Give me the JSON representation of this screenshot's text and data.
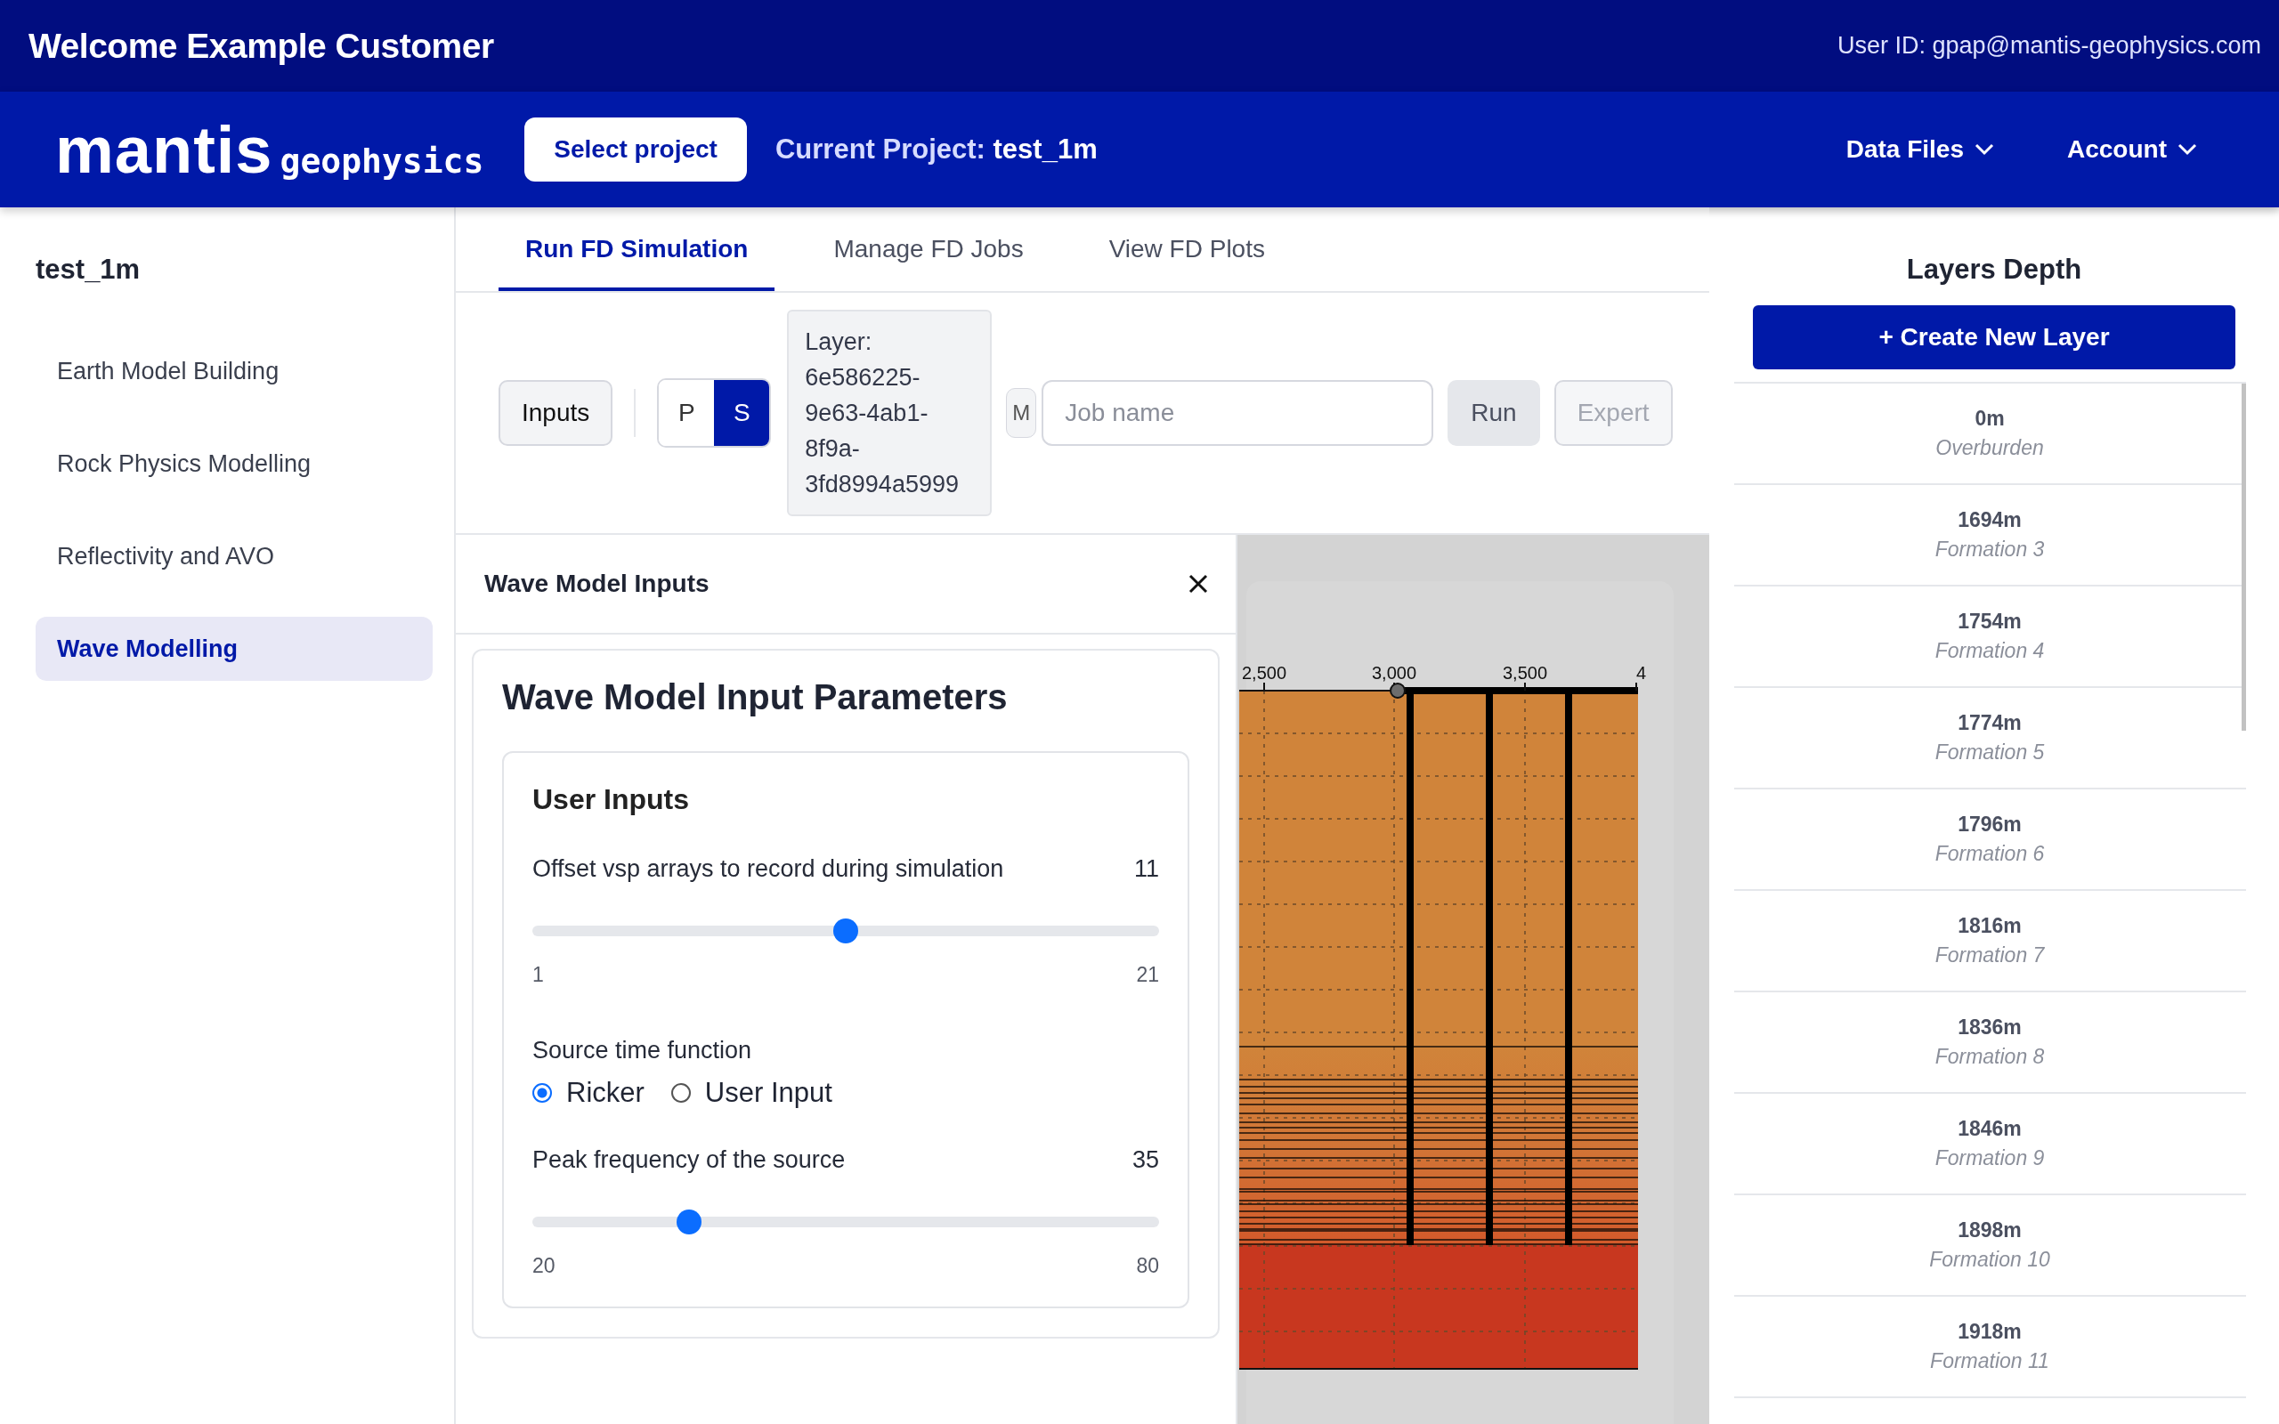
{
  "header": {
    "welcome": "Welcome Example Customer",
    "user_id": "User ID: gpap@mantis-geophysics.com"
  },
  "navbar": {
    "logo_main": "mantis",
    "logo_sub": "geophysics",
    "select_project": "Select project",
    "current_project_label": "Current Project:",
    "current_project": "test_1m",
    "menus": [
      "Data Files",
      "Account"
    ]
  },
  "sidebar": {
    "project": "test_1m",
    "items": [
      {
        "label": "Earth Model Building",
        "selected": false
      },
      {
        "label": "Rock Physics Modelling",
        "selected": false
      },
      {
        "label": "Reflectivity and AVO",
        "selected": false
      },
      {
        "label": "Wave Modelling",
        "selected": true
      }
    ]
  },
  "tabs": [
    {
      "label": "Run FD Simulation",
      "selected": true
    },
    {
      "label": "Manage FD Jobs",
      "selected": false
    },
    {
      "label": "View FD Plots",
      "selected": false
    }
  ],
  "toolbar": {
    "inputs_button": "Inputs",
    "wave_types": [
      {
        "label": "P",
        "selected": false
      },
      {
        "label": "S",
        "selected": true
      }
    ],
    "layer_info": "Layer: 6e586225-9e63-4ab1-8f9a-3fd8994a5999",
    "partial_button": "M",
    "job_name": {
      "placeholder": "Job name"
    },
    "run_button": {
      "label": "Run",
      "disabled": false
    },
    "expert_button": {
      "label": "Expert",
      "disabled": true
    }
  },
  "panel": {
    "title": "Wave Model Inputs",
    "card_title": "Wave Model Input Parameters",
    "section_title": "User Inputs",
    "controls": [
      {
        "kind": "slider",
        "label": "Offset vsp arrays to record during simulation",
        "value": "11",
        "level": 0.5,
        "min": "1",
        "max": "21"
      },
      {
        "kind": "radio",
        "label": "Source time function",
        "options": [
          {
            "label": "Ricker",
            "selected": true
          },
          {
            "label": "User Input",
            "selected": false
          }
        ]
      },
      {
        "kind": "slider",
        "label": "Peak frequency of the source",
        "value": "35",
        "level": 0.25,
        "min": "20",
        "max": "80"
      }
    ]
  },
  "plot": {
    "x_ticks": [
      "2,500",
      "3,000",
      "3,500",
      "4"
    ]
  },
  "layers": {
    "title": "Layers Depth",
    "create_button": "+ Create New Layer",
    "items": [
      {
        "depth": "0m",
        "name": "Overburden"
      },
      {
        "depth": "1694m",
        "name": "Formation 3"
      },
      {
        "depth": "1754m",
        "name": "Formation 4"
      },
      {
        "depth": "1774m",
        "name": "Formation 5"
      },
      {
        "depth": "1796m",
        "name": "Formation 6"
      },
      {
        "depth": "1816m",
        "name": "Formation 7"
      },
      {
        "depth": "1836m",
        "name": "Formation 8"
      },
      {
        "depth": "1846m",
        "name": "Formation 9"
      },
      {
        "depth": "1898m",
        "name": "Formation 10"
      },
      {
        "depth": "1918m",
        "name": "Formation 11"
      }
    ]
  }
}
